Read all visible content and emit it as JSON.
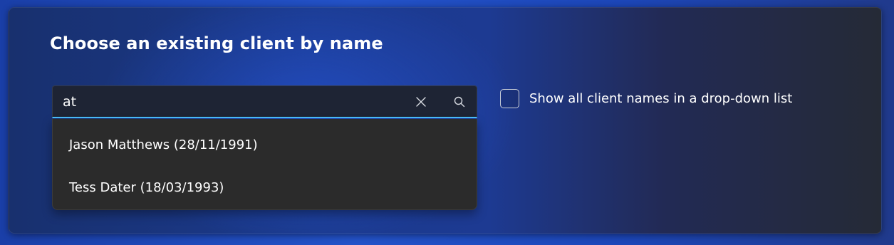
{
  "dialog": {
    "title": "Choose an existing client by name"
  },
  "search": {
    "value": "at",
    "clear_icon": "close-icon",
    "search_icon": "search-icon",
    "accent_color": "#4cc2ff"
  },
  "suggestions": [
    {
      "label": "Jason Matthews (28/11/1991)"
    },
    {
      "label": "Tess Dater (18/03/1993)"
    }
  ],
  "show_all_option": {
    "label": "Show all client names in a drop-down list",
    "checked": false
  }
}
